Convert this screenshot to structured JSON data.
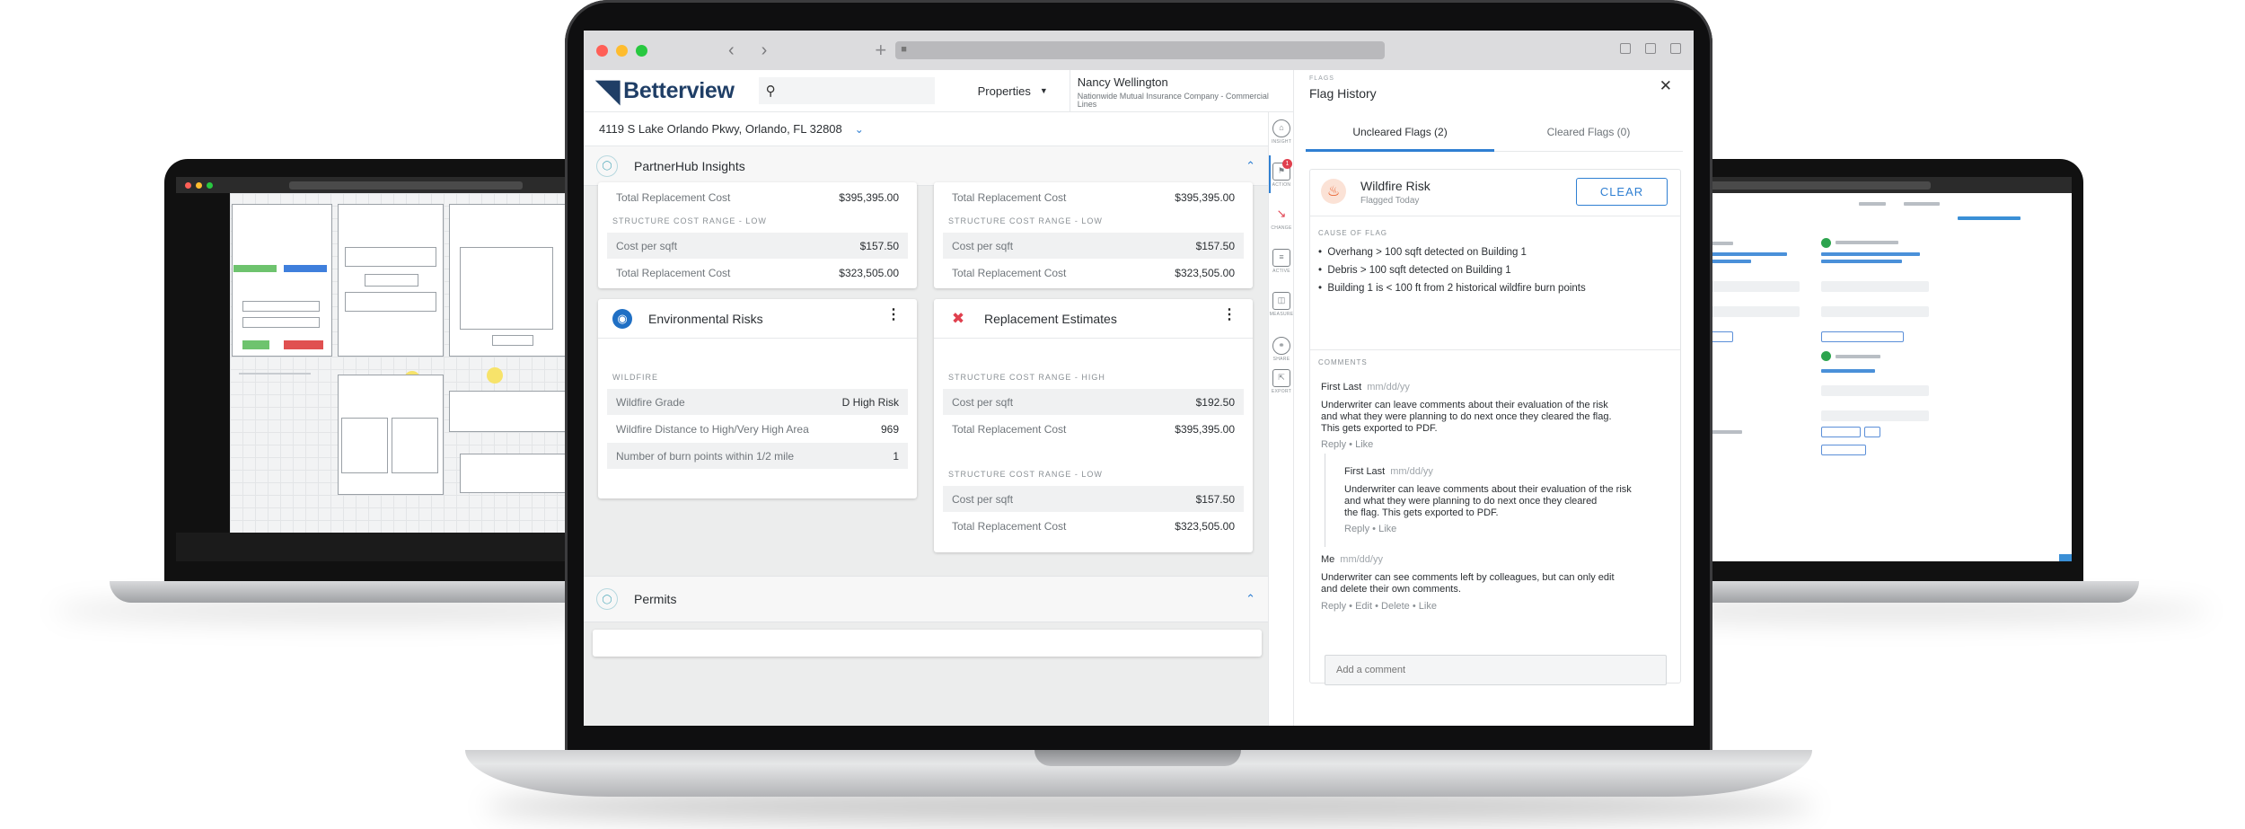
{
  "browser": {
    "back": "‹",
    "forward": "›",
    "new_tab": "+"
  },
  "app": {
    "brand": "Betterview",
    "search": {
      "value": "",
      "placeholder": ""
    },
    "properties_label": "Properties",
    "user": {
      "name": "Nancy Wellington",
      "company": "Nationwide Mutual Insurance Company - Commercial Lines"
    },
    "address": "4119 S Lake Orlando Pkwy, Orlando, FL 32808"
  },
  "sections": {
    "insights_title": "PartnerHub Insights",
    "permits_title": "Permits"
  },
  "top_cards": [
    {
      "rows": [
        {
          "label": "Total Replacement Cost",
          "value": "$395,395.00"
        },
        {
          "label": "Cost per sqft",
          "value": "$157.50"
        },
        {
          "label": "Total Replacement Cost",
          "value": "$323,505.00"
        }
      ],
      "low_caption": "STRUCTURE COST RANGE - LOW"
    },
    {
      "rows": [
        {
          "label": "Total Replacement Cost",
          "value": "$395,395.00"
        },
        {
          "label": "Cost per sqft",
          "value": "$157.50"
        },
        {
          "label": "Total Replacement Cost",
          "value": "$323,505.00"
        }
      ],
      "low_caption": "STRUCTURE COST RANGE - LOW"
    }
  ],
  "environmental": {
    "title": "Environmental Risks",
    "caption": "WILDFIRE",
    "rows": [
      {
        "label": "Wildfire Grade",
        "value": "D High Risk"
      },
      {
        "label": "Wildfire Distance to High/Very High Area",
        "value": "969"
      },
      {
        "label": "Number of burn points within 1/2 mile",
        "value": "1"
      }
    ]
  },
  "replacement": {
    "title": "Replacement Estimates",
    "high_caption": "STRUCTURE COST RANGE - HIGH",
    "low_caption": "STRUCTURE COST RANGE - LOW",
    "rows": [
      {
        "label": "Cost per sqft",
        "value": "$192.50"
      },
      {
        "label": "Total Replacement Cost",
        "value": "$395,395.00"
      },
      {
        "label": "Cost per sqft",
        "value": "$157.50"
      },
      {
        "label": "Total Replacement Cost",
        "value": "$323,505.00"
      }
    ]
  },
  "rail": [
    {
      "label": "INSIGHT",
      "icon": "home-icon"
    },
    {
      "label": "ACTION",
      "icon": "flag-icon",
      "badge": "1"
    },
    {
      "label": "CHANGE",
      "icon": "arrow-icon"
    },
    {
      "label": "ACTIVE",
      "icon": "document-icon"
    },
    {
      "label": "MEASURE",
      "icon": "ruler-icon"
    },
    {
      "label": "SHARE",
      "icon": "share-icon"
    },
    {
      "label": "EXPORT",
      "icon": "export-icon"
    }
  ],
  "flag_panel": {
    "kicker": "FLAGS",
    "title": "Flag History",
    "tabs": [
      "Uncleared Flags (2)",
      "Cleared Flags (0)"
    ],
    "flag": {
      "name": "Wildfire Risk",
      "sub": "Flagged Today",
      "clear_label": "CLEAR"
    },
    "cause_caption": "CAUSE OF FLAG",
    "causes": [
      "Overhang > 100 sqft detected on Building 1",
      "Debris > 100 sqft detected on Building 1",
      "Building 1 is < 100 ft from 2 historical wildfire burn points"
    ],
    "comments_caption": "COMMENTS",
    "comments": [
      {
        "name": "First Last",
        "date": "mm/dd/yy",
        "body": [
          "Underwriter can leave comments about their evaluation of the risk",
          "and what they were planning to do next once they cleared the flag.",
          "This gets exported to PDF."
        ],
        "actions": "Reply  •  Like"
      },
      {
        "name": "First Last",
        "date": "mm/dd/yy",
        "body": [
          "Underwriter can leave comments about their evaluation of the risk",
          "and what they were planning to do next once they cleared",
          "the flag. This gets exported to PDF."
        ],
        "actions": "Reply  •  Like"
      },
      {
        "name": "Me",
        "date": "mm/dd/yy",
        "body": [
          "Underwriter can see comments left by colleagues, but can only edit",
          "and delete their own comments."
        ],
        "actions": "Reply  •  Edit  •  Delete  •  Like"
      }
    ],
    "add_comment_placeholder": "Add a comment"
  },
  "colors": {
    "accent": "#2f7fd2",
    "brand": "#1f3e66",
    "badge": "#e0404e",
    "wildfire": "#e8551f"
  }
}
